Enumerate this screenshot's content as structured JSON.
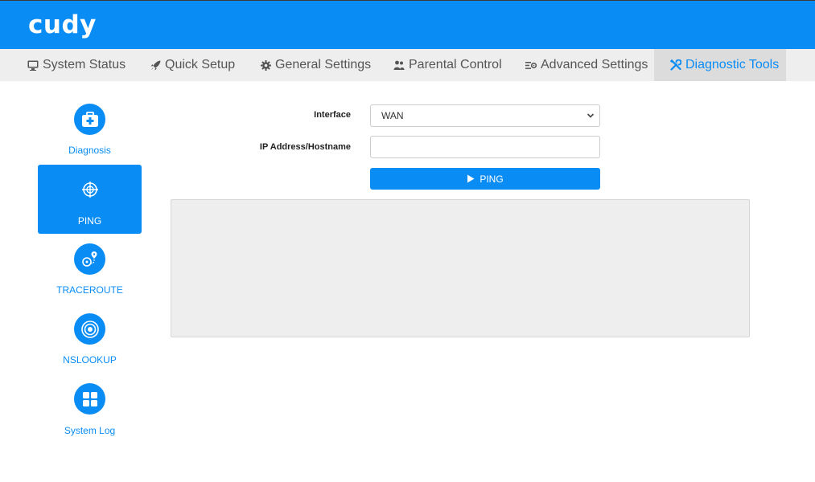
{
  "brand": {
    "logo_text": "cudy",
    "color": "#0a8cf5"
  },
  "nav": {
    "items": [
      {
        "label": "System Status",
        "icon": "monitor-icon"
      },
      {
        "label": "Quick Setup",
        "icon": "rocket-icon"
      },
      {
        "label": "General Settings",
        "icon": "gear-icon"
      },
      {
        "label": "Parental Control",
        "icon": "users-icon"
      },
      {
        "label": "Advanced Settings",
        "icon": "list-gear-icon"
      },
      {
        "label": "Diagnostic Tools",
        "icon": "tools-icon",
        "active": true
      }
    ]
  },
  "sidebar": {
    "items": [
      {
        "label": "Diagnosis",
        "icon": "medkit-icon"
      },
      {
        "label": "PING",
        "icon": "crosshair-globe-icon",
        "active": true
      },
      {
        "label": "TRACEROUTE",
        "icon": "route-icon"
      },
      {
        "label": "NSLOOKUP",
        "icon": "radar-icon"
      },
      {
        "label": "System Log",
        "icon": "grid-icon"
      }
    ]
  },
  "form": {
    "interface_label": "Interface",
    "interface_value": "WAN",
    "host_label": "IP Address/Hostname",
    "host_value": "",
    "host_placeholder": "",
    "ping_button": "PING"
  },
  "output": {
    "text": ""
  }
}
